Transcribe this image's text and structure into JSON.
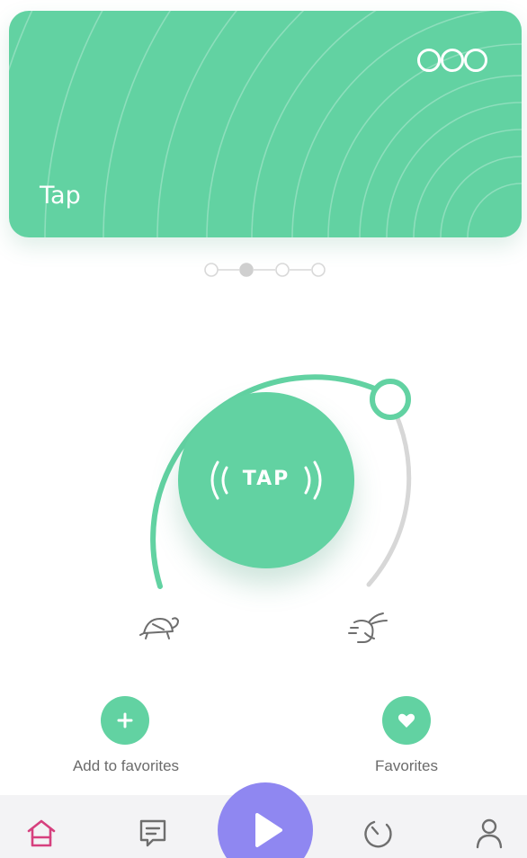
{
  "card": {
    "title": "Tap",
    "menu_icon": "more-circles-icon",
    "color": "#62d2a2"
  },
  "pager": {
    "count": 4,
    "active_index": 1
  },
  "dial": {
    "button_label": "TAP",
    "slow_icon": "turtle-icon",
    "fast_icon": "rabbit-icon",
    "track_color": "#62d2a2",
    "rest_color": "#d7d7d7"
  },
  "actions": {
    "add_favorites_label": "Add to favorites",
    "favorites_label": "Favorites"
  },
  "tabbar": {
    "items": [
      {
        "icon": "home-icon",
        "active": true
      },
      {
        "icon": "chat-icon",
        "active": false
      },
      {
        "icon": "play-icon",
        "active": false
      },
      {
        "icon": "timer-icon",
        "active": false
      },
      {
        "icon": "profile-icon",
        "active": false
      }
    ],
    "active_color": "#d6407e",
    "play_color": "#8f87f1"
  }
}
